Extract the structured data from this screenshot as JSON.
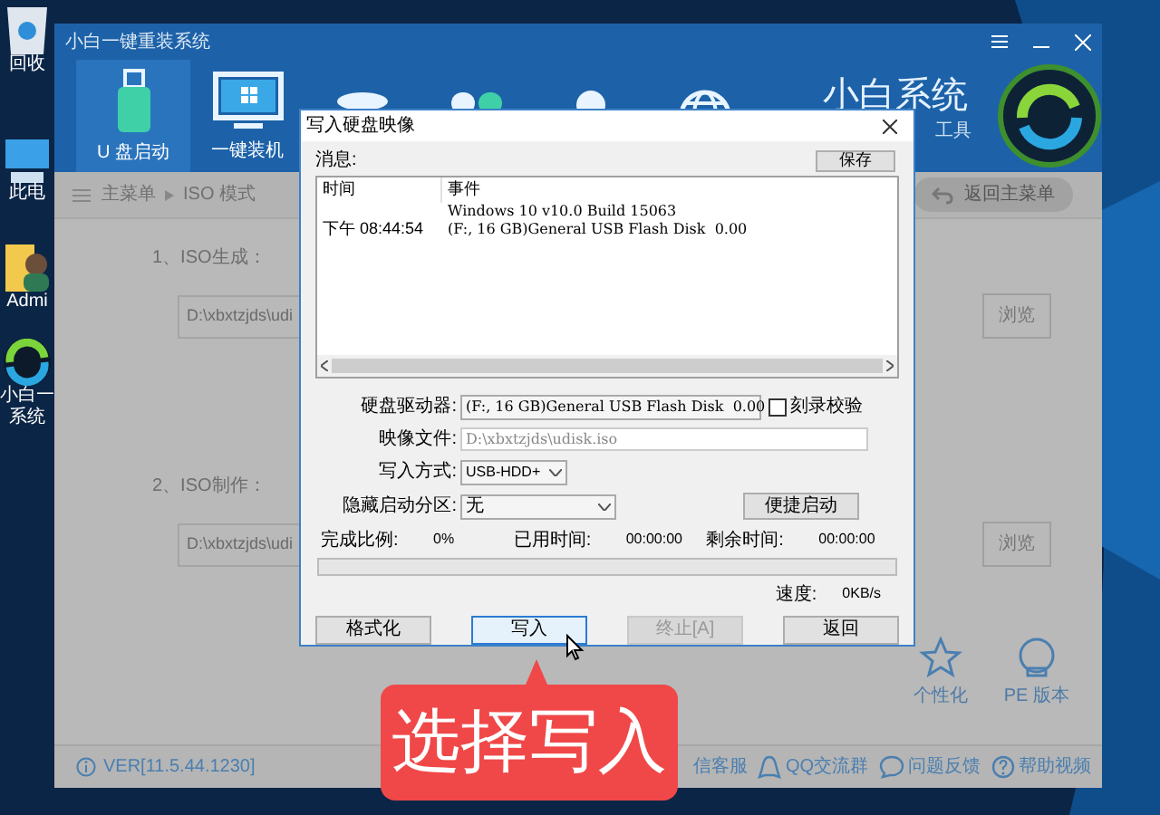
{
  "desktop_icons": [
    {
      "label": "回收",
      "kind": "recycle"
    },
    {
      "label": "此电",
      "kind": "computer"
    },
    {
      "label": "Admi",
      "kind": "folder"
    },
    {
      "label": "小白一",
      "label_2": "系统",
      "kind": "app"
    }
  ],
  "app": {
    "title": "小白一键重装系统",
    "tabs": [
      {
        "label": "U 盘启动",
        "selected": true,
        "kind": "usb"
      },
      {
        "label": "一键装机",
        "selected": false,
        "kind": "monitor"
      },
      {
        "selected": false,
        "kind": "database"
      },
      {
        "selected": false,
        "kind": "clover"
      },
      {
        "selected": false,
        "kind": "person"
      },
      {
        "selected": false,
        "kind": "globe"
      }
    ],
    "brand": {
      "name": "小白系统",
      "subtitle": "工具"
    },
    "breadcrumb": [
      "主菜单",
      "ISO 模式"
    ],
    "back_button": "返回主菜单",
    "sections": [
      {
        "label": "1、ISO生成：",
        "value": "D:\\xbxtzjds\\udi",
        "button": "浏览"
      },
      {
        "label": "2、ISO制作：",
        "value": "D:\\xbxtzjds\\udi",
        "button": "浏览"
      }
    ],
    "side_actions": [
      {
        "label": "个性化",
        "kind": "star"
      },
      {
        "label": "PE 版本",
        "kind": "pe"
      }
    ],
    "footer": {
      "version": "VER[11.5.44.1230]",
      "links": [
        {
          "label": "信客服"
        },
        {
          "label": "QQ交流群",
          "kind": "qq"
        },
        {
          "label": "问题反馈",
          "kind": "chat"
        },
        {
          "label": "帮助视频",
          "kind": "help"
        }
      ]
    }
  },
  "dialog": {
    "title": "写入硬盘映像",
    "message_label": "消息:",
    "save_button": "保存",
    "log": {
      "columns": [
        "时间",
        "事件"
      ],
      "rows": [
        {
          "event": "Windows 10 v10.0 Build 15063"
        },
        {
          "time": "下午 08:44:54",
          "event": "(F:, 16 GB)General USB Flash Disk  0.00"
        }
      ]
    },
    "drive": {
      "label": "硬盘驱动器:",
      "value": "(F:, 16 GB)General USB Flash Disk  0.00"
    },
    "verify": {
      "label": "刻录校验",
      "checked": false
    },
    "image_file": {
      "label": "映像文件:",
      "value": "D:\\xbxtzjds\\udisk.iso"
    },
    "write_mode": {
      "label": "写入方式:",
      "value": "USB-HDD+"
    },
    "hidden_partition": {
      "label": "隐藏启动分区:",
      "value": "无"
    },
    "quick_boot_button": "便捷启动",
    "stats": [
      {
        "label": "完成比例:",
        "value": "0%"
      },
      {
        "label": "已用时间:",
        "value": "00:00:00"
      },
      {
        "label": "剩余时间:",
        "value": "00:00:00"
      }
    ],
    "progress": {
      "level": 0
    },
    "speed": {
      "label": "速度:",
      "value": "0KB/s"
    },
    "buttons": [
      {
        "label": "格式化",
        "focused": false,
        "disabled": false
      },
      {
        "label": "写入",
        "focused": true,
        "disabled": false
      },
      {
        "label": "终止[A]",
        "focused": false,
        "disabled": true
      },
      {
        "label": "返回",
        "focused": false,
        "disabled": false
      }
    ]
  },
  "callout": {
    "text": "选择写入"
  }
}
